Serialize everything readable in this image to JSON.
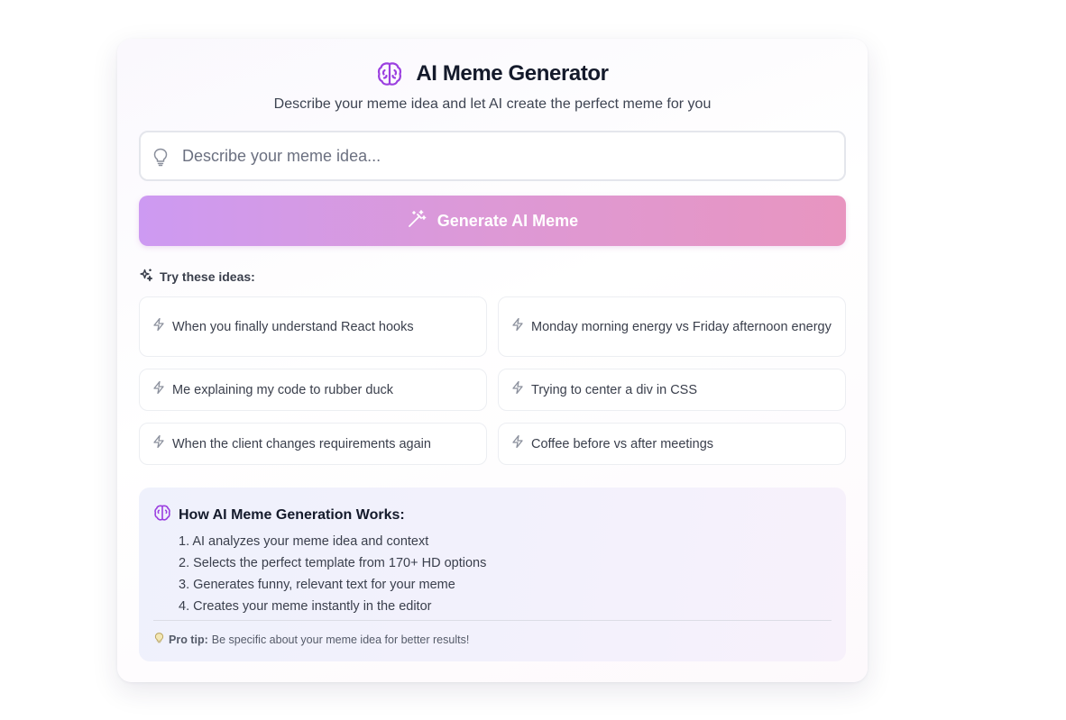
{
  "header": {
    "title": "AI Meme Generator",
    "icon": "brain-icon",
    "subtitle": "Describe your meme idea and let AI create the perfect meme for you"
  },
  "input": {
    "placeholder": "Describe your meme idea...",
    "value": ""
  },
  "generate_button": {
    "label": "Generate AI Meme",
    "icon": "magic-wand-icon"
  },
  "ideas": {
    "label": "Try these ideas:",
    "items": [
      "When you finally understand React hooks",
      "Monday morning energy vs Friday afternoon energy",
      "Me explaining my code to rubber duck",
      "Trying to center a div in CSS",
      "When the client changes requirements again",
      "Coffee before vs after meetings"
    ]
  },
  "how_it_works": {
    "title": "How AI Meme Generation Works:",
    "steps": [
      "1. AI analyzes your meme idea and context",
      "2. Selects the perfect template from 170+ HD options",
      "3. Generates funny, relevant text for your meme",
      "4. Creates your meme instantly in the editor"
    ],
    "tip_label": "Pro tip:",
    "tip_text": "Be specific about your meme idea for better results!"
  },
  "colors": {
    "accent": "#9b3fe0",
    "button_start": "#cd9af2",
    "button_end": "#e895c0"
  }
}
